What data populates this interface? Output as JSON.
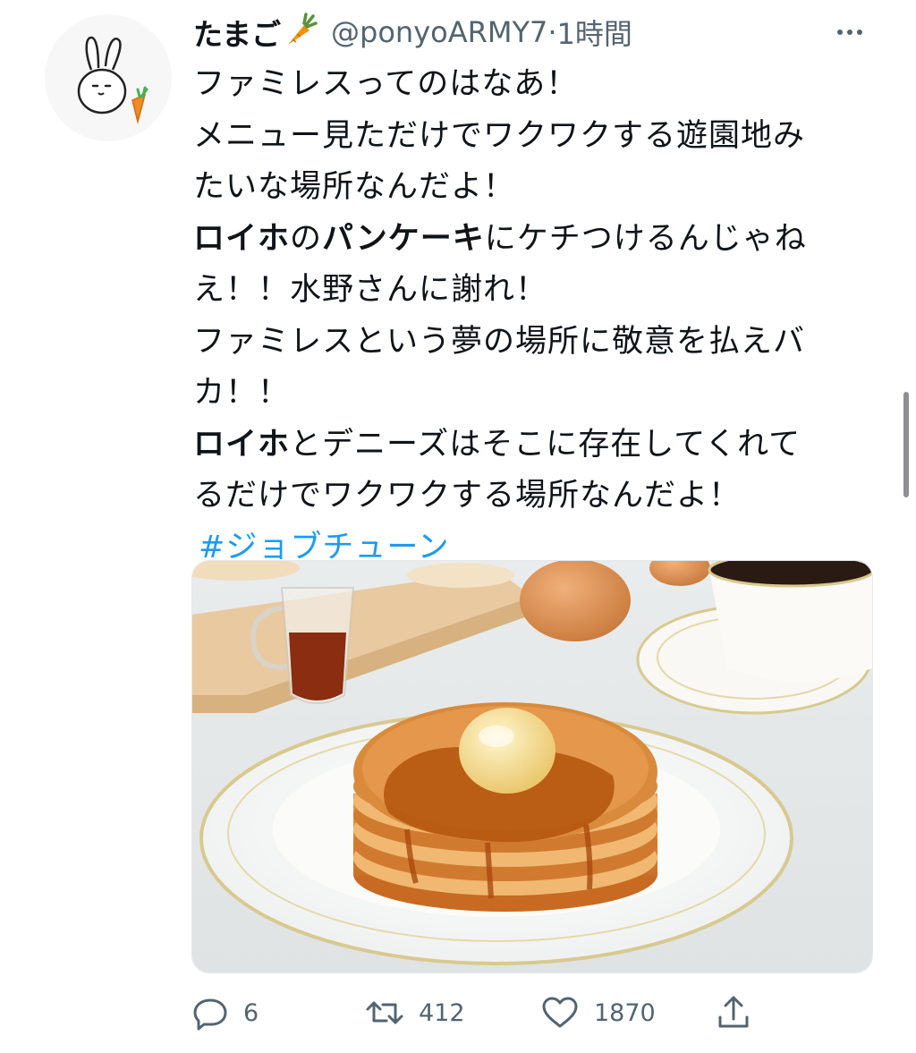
{
  "tweet": {
    "display_name": "たまご",
    "display_name_emoji": "carrot-emoji",
    "handle": "@ponyoARMY7",
    "separator": "·",
    "time": "1時間",
    "text": {
      "l1": "ファミレスってのはなあ！",
      "l2": "メニュー見ただけでワクワクする遊園地み",
      "l3": "たいな場所なんだよ！",
      "l4_b1": "ロイホ",
      "l4_t1": "の",
      "l4_b2": "パンケーキ",
      "l4_t2": "にケチつけるんじゃね",
      "l5": "え！！水野さんに謝れ！",
      "l6": "ファミレスという夢の場所に敬意を払えバ",
      "l7": "カ！！",
      "l8_b1": "ロイホ",
      "l8_t1": "とデニーズはそこに存在してくれて",
      "l9": "るだけでワクワクする場所なんだよ！",
      "hashtag": "#ジョブチューン"
    },
    "media": {
      "description_icon": "pancake-photo",
      "accent_syrup": "#b5560f",
      "accent_pancake": "#d98a3a"
    },
    "actions": {
      "reply_count": "6",
      "retweet_count": "412",
      "like_count": "1870"
    }
  },
  "colors": {
    "text": "#0f1419",
    "secondary": "#536471",
    "link": "#1d9bf0"
  }
}
